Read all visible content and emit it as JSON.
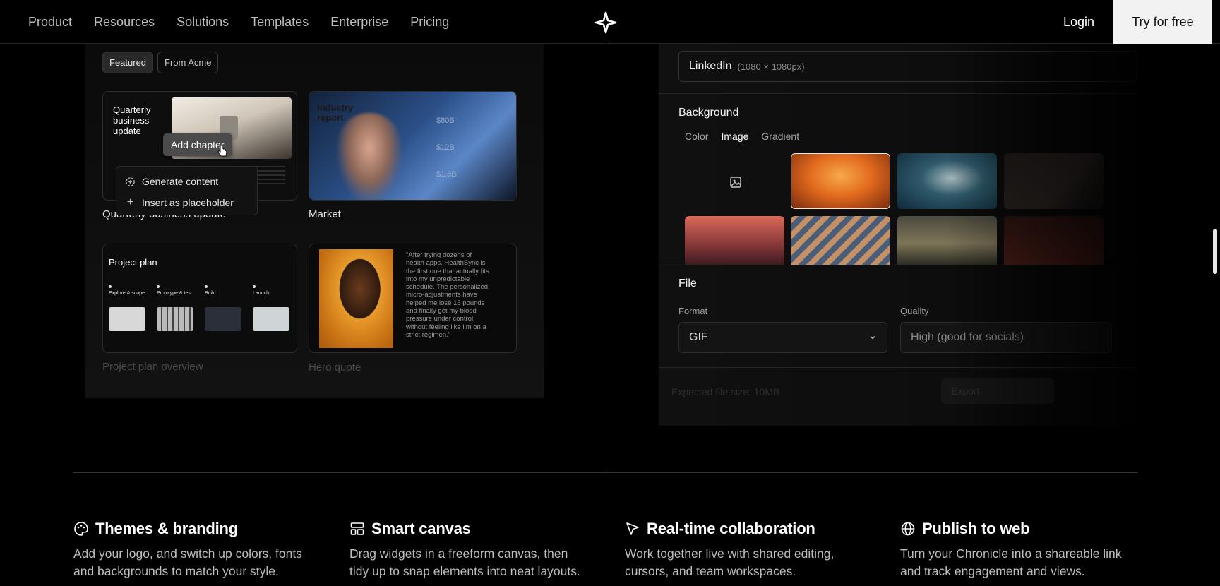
{
  "nav": {
    "links": [
      "Product",
      "Resources",
      "Solutions",
      "Templates",
      "Enterprise",
      "Pricing"
    ],
    "login": "Login",
    "cta": "Try for free"
  },
  "templates": {
    "filters": [
      "Featured",
      "From Acme"
    ],
    "cards": [
      {
        "caption": "Quarterly business update",
        "thumb_title": "Quarterly business update"
      },
      {
        "caption": "Market",
        "thumb_title": "Industry report",
        "thumb_values": [
          "$80B",
          "$12B",
          "$1.6B"
        ]
      },
      {
        "caption": "Project plan overview",
        "thumb_title": "Project plan",
        "phases": [
          "Explore & scope",
          "Prototype & test",
          "Build",
          "Launch"
        ]
      },
      {
        "caption": "Hero quote",
        "quote": "\"After trying dozens of health apps, HealthSync is the first one that actually fits into my unpredictable schedule. The personalized micro-adjustments have helped me lose 15 pounds and finally get my blood pressure under control without feeling like I'm on a strict regimen.\""
      }
    ],
    "add_chapter": "Add chapter",
    "menu": [
      {
        "icon": "sparkle-icon",
        "label": "Generate content"
      },
      {
        "icon": "plus-icon",
        "label": "Insert as placeholder"
      }
    ]
  },
  "export": {
    "size_label": "LinkedIn",
    "size_dims": "(1080 × 1080px)",
    "background_title": "Background",
    "background_tabs": [
      "Color",
      "Image",
      "Gradient"
    ],
    "background_selected": "Image",
    "file_title": "File",
    "format_label": "Format",
    "format_value": "GIF",
    "quality_label": "Quality",
    "quality_value": "High (good for socials)",
    "estimate": "Expected file size: 10MB",
    "export_button": "Export"
  },
  "features": [
    {
      "icon": "palette-icon",
      "title": "Themes & branding",
      "desc": "Add your logo, and switch up colors, fonts and backgrounds to match your style."
    },
    {
      "icon": "layout-icon",
      "title": "Smart canvas",
      "desc": "Drag widgets in a freeform canvas, then tidy up to snap elements into neat layouts."
    },
    {
      "icon": "cursor-icon",
      "title": "Real-time collaboration",
      "desc": "Work together live with shared editing, cursors, and team workspaces."
    },
    {
      "icon": "globe-icon",
      "title": "Publish to web",
      "desc": "Turn your Chronicle into a shareable link and track engagement and views."
    }
  ]
}
